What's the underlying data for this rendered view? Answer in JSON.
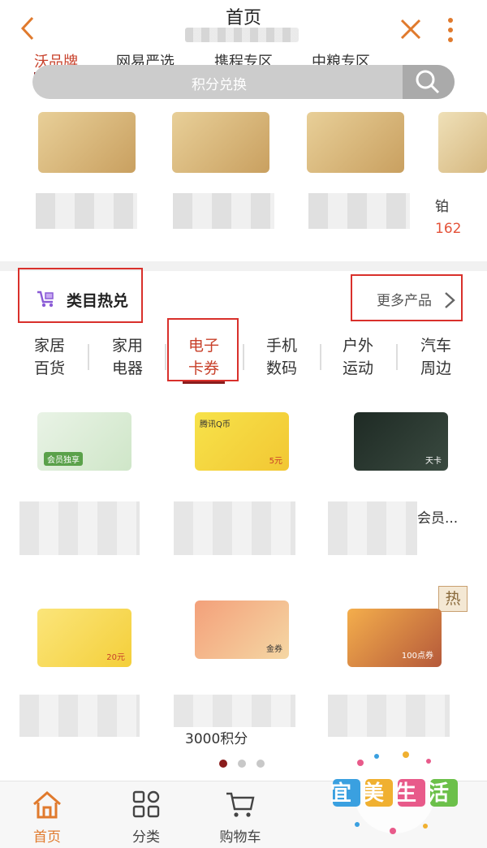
{
  "header": {
    "title": "首页"
  },
  "brand_tabs": [
    "沃品牌",
    "网易严选",
    "携程专区",
    "中粮专区"
  ],
  "search": {
    "label": "积分兑换"
  },
  "top_products": {
    "cut_title": "铂",
    "cut_price": "162"
  },
  "section": {
    "title": "类目热兑",
    "more": "更多产品"
  },
  "categories": [
    {
      "line1": "家居",
      "line2": "百货"
    },
    {
      "line1": "家用",
      "line2": "电器"
    },
    {
      "line1": "电子",
      "line2": "卡券"
    },
    {
      "line1": "手机",
      "line2": "数码"
    },
    {
      "line1": "户外",
      "line2": "运动"
    },
    {
      "line1": "汽车",
      "line2": "周边"
    }
  ],
  "grid": {
    "card_texts": {
      "c1": "会员独享",
      "c2": "腾讯Q币",
      "c2_price": "5元",
      "c3": "天卡",
      "c4": "20元",
      "c5": "金券",
      "c6": "100点券"
    },
    "item3_name": "会员...",
    "item5_points": "3000积分",
    "hot_badge": "热"
  },
  "pagination": {
    "active": 0,
    "count": 3
  },
  "bottom_nav": [
    {
      "label": "首页",
      "icon": "home-icon"
    },
    {
      "label": "分类",
      "icon": "category-icon"
    },
    {
      "label": "购物车",
      "icon": "cart-icon"
    }
  ],
  "watermark": {
    "text": "宜美生活"
  },
  "colors": {
    "accent": "#c8402a",
    "highlight_box": "#d9302b",
    "nav_active": "#e07a2d"
  }
}
